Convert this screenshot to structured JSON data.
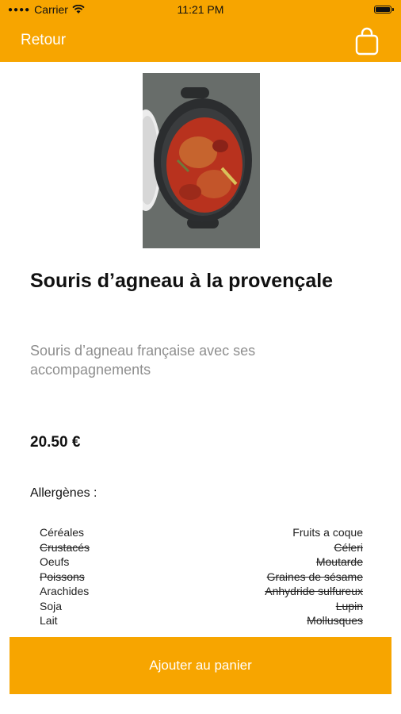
{
  "status_bar": {
    "carrier": "Carrier",
    "time": "11:21 PM"
  },
  "nav": {
    "back_label": "Retour",
    "cart_icon": "shopping-bag-icon"
  },
  "product": {
    "title": "Souris d’agneau à la provençale",
    "description": "Souris d’agneau française avec ses accompagnements",
    "price": "20.50 €"
  },
  "allergens": {
    "heading": "Allergènes :",
    "left": [
      {
        "label": "Céréales",
        "present": true
      },
      {
        "label": "Crustacés",
        "present": false
      },
      {
        "label": "Oeufs",
        "present": true
      },
      {
        "label": "Poissons",
        "present": false
      },
      {
        "label": "Arachides",
        "present": true
      },
      {
        "label": "Soja",
        "present": true
      },
      {
        "label": "Lait",
        "present": true
      }
    ],
    "right": [
      {
        "label": "Fruits a coque",
        "present": true
      },
      {
        "label": "Céleri",
        "present": false
      },
      {
        "label": "Moutarde",
        "present": false
      },
      {
        "label": "Graines de sésame",
        "present": false
      },
      {
        "label": "Anhydride sulfureux",
        "present": false
      },
      {
        "label": "Lupin",
        "present": false
      },
      {
        "label": "Mollusques",
        "present": false
      }
    ]
  },
  "actions": {
    "add_to_cart_label": "Ajouter au panier"
  },
  "colors": {
    "accent": "#F7A500",
    "muted_text": "#8e8e8e"
  }
}
